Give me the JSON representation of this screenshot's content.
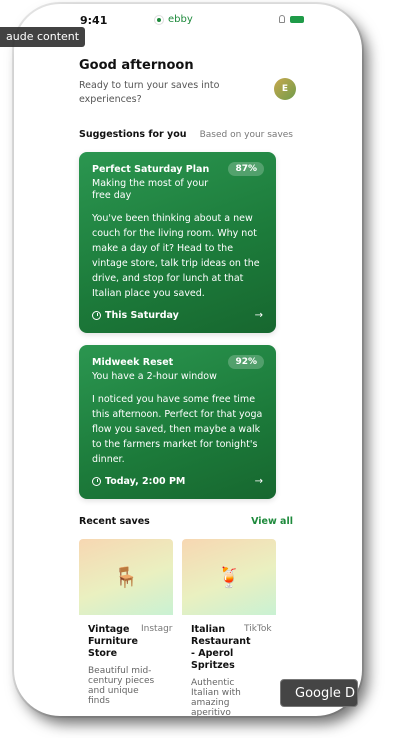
{
  "status": {
    "time": "9:41",
    "app_name": "ebby"
  },
  "overlay": {
    "label": "aude content"
  },
  "greeting": {
    "title": "Good afternoon",
    "subtitle": "Ready to turn your saves into experiences?",
    "avatar_initial": "E"
  },
  "suggestions": {
    "title": "Suggestions for you",
    "meta": "Based on your saves",
    "cards": [
      {
        "title": "Perfect Saturday Plan",
        "match": "87%",
        "subtitle": "Making the most of your free day",
        "body": "You've been thinking about a new couch for the living room. Why not make a day of it? Head to the vintage store, talk trip ideas on the drive, and stop for lunch at that Italian place you saved.",
        "when": "This Saturday"
      },
      {
        "title": "Midweek Reset",
        "match": "92%",
        "subtitle": "You have a 2-hour window",
        "body": "I noticed you have some free time this afternoon. Perfect for that yoga flow you saved, then maybe a walk to the farmers market for tonight's dinner.",
        "when": "Today, 2:00 PM"
      }
    ]
  },
  "recent": {
    "title": "Recent saves",
    "view_all": "View all",
    "items": [
      {
        "title": "Vintage Furniture Store",
        "source": "Instagram",
        "desc": "Beautiful mid-century pieces and unique finds",
        "icon": "chair-icon",
        "glyph": "🪑"
      },
      {
        "title": "Italian Restaurant - Aperol Spritzes",
        "source": "TikTok",
        "desc": "Authentic Italian with amazing aperitivo",
        "icon": "cocktail-icon",
        "glyph": "🍹"
      }
    ]
  },
  "google_overlay": {
    "label": "Google D"
  },
  "colors": {
    "brand_green": "#1e8a3c",
    "card_green": "#1c7a3a"
  }
}
